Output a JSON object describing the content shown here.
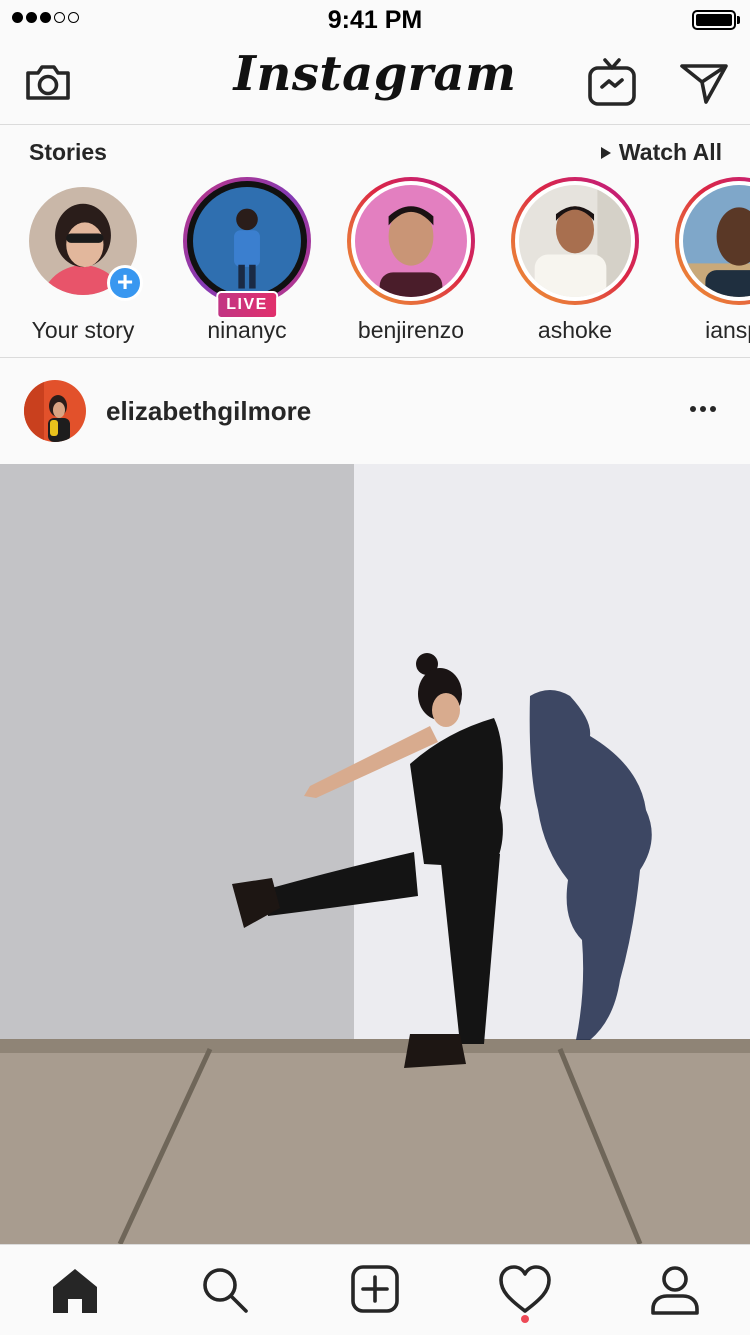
{
  "status_bar": {
    "signal": [
      true,
      true,
      true,
      false,
      false
    ],
    "time": "9:41 PM"
  },
  "header": {
    "logo": "Instagram",
    "icons": {
      "camera": "camera-icon",
      "igtv": "igtv-icon",
      "direct": "direct-message-icon"
    }
  },
  "stories": {
    "title": "Stories",
    "watch_all": "Watch All",
    "items": [
      {
        "label": "Your story"
      },
      {
        "label": "ninanyc",
        "badge": "LIVE"
      },
      {
        "label": "benjirenzo"
      },
      {
        "label": "ashoke"
      },
      {
        "label": "ianspa"
      }
    ]
  },
  "post": {
    "username": "elizabethgilmore"
  },
  "tab_bar": {
    "tabs": [
      "home-icon",
      "search-icon",
      "add-post-icon",
      "activity-icon",
      "profile-icon"
    ],
    "active": "home",
    "activity_notification": true
  },
  "colors": {
    "accent_blue": "#3897f0",
    "story_ring": "#dc2743",
    "live_badge": "#e1306c",
    "notification_dot": "#ed4956"
  }
}
